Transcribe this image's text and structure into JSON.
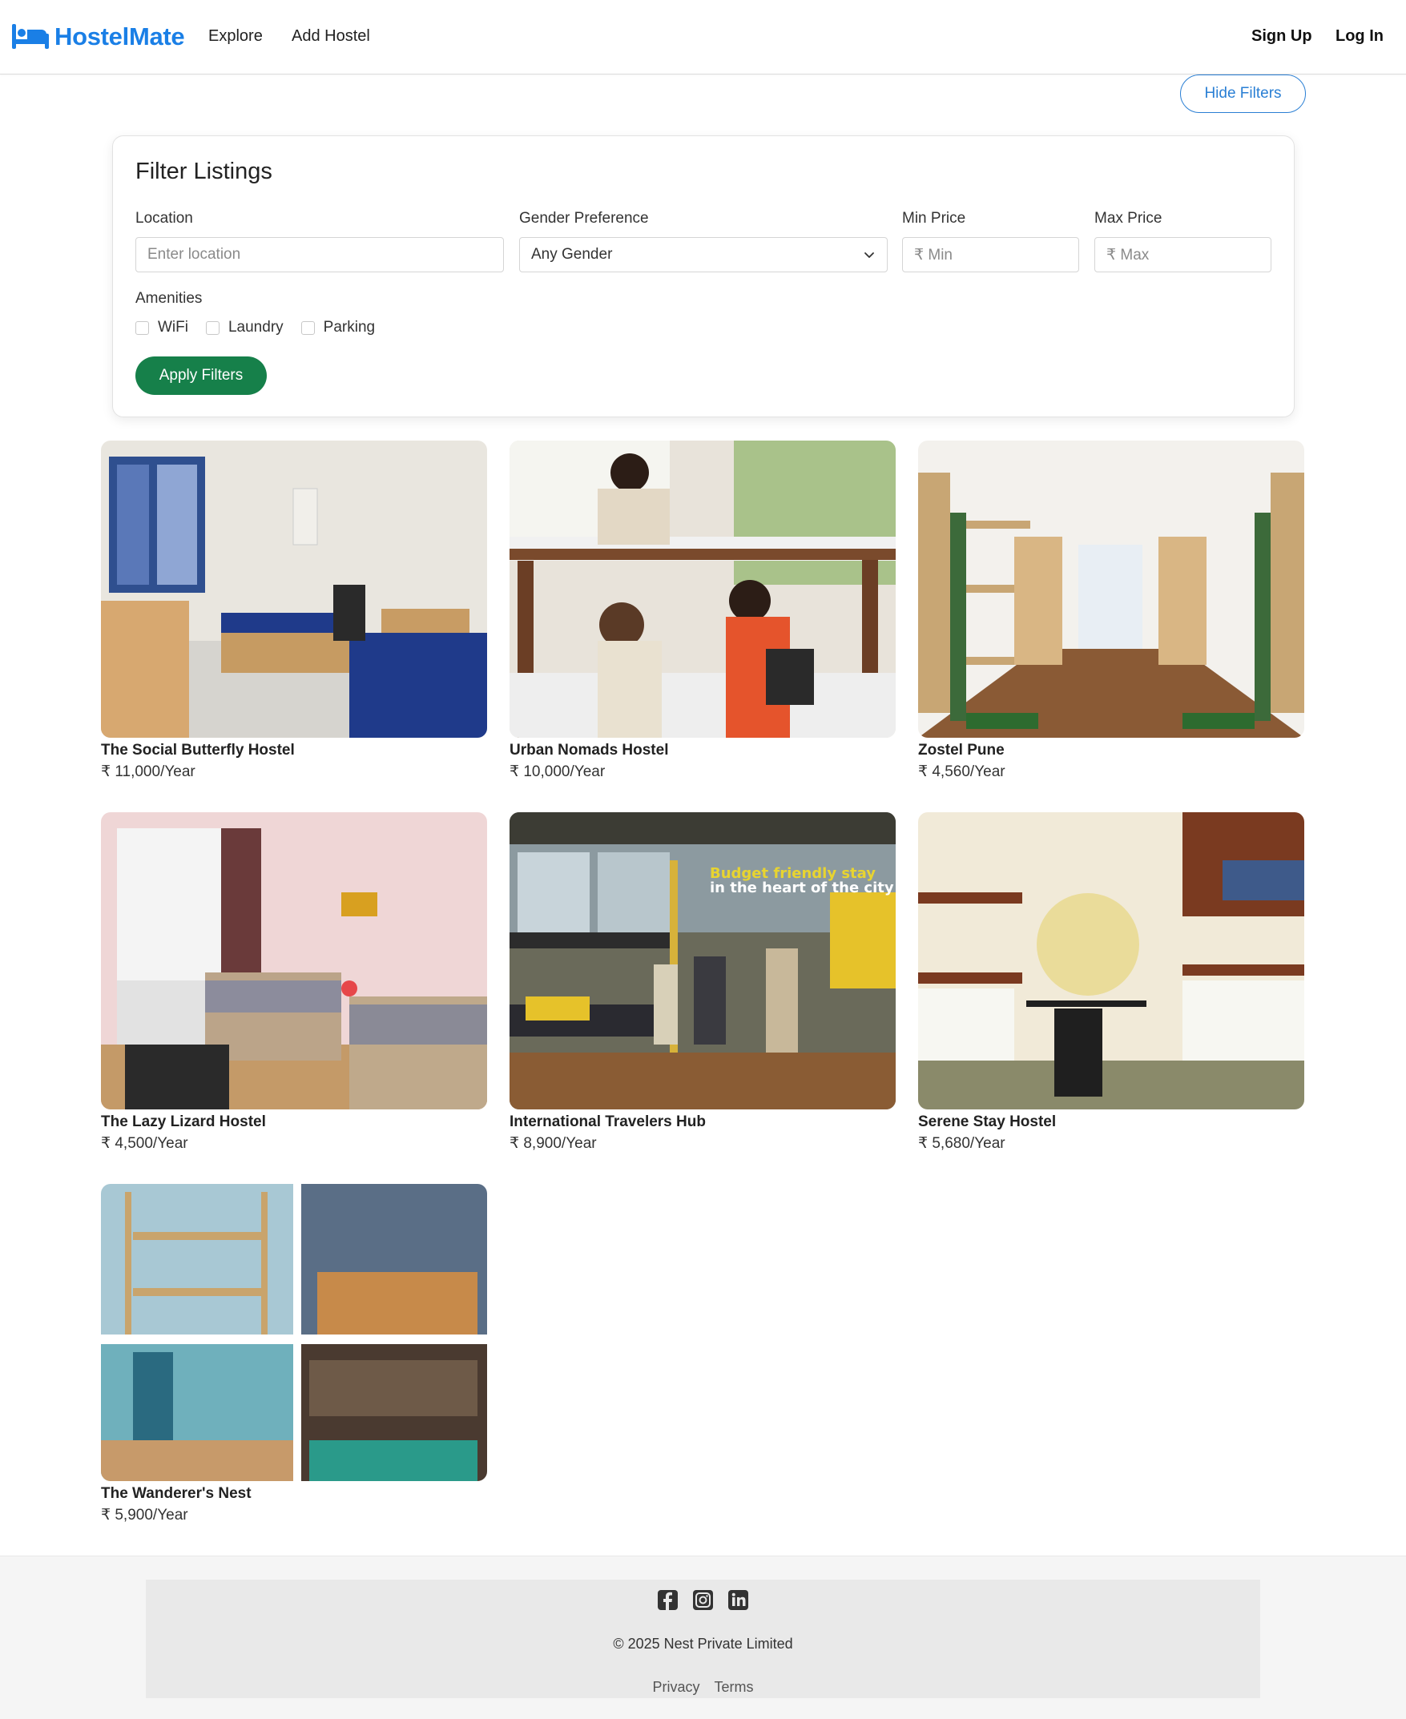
{
  "navbar": {
    "brand": "HostelMate",
    "links": {
      "explore": "Explore",
      "add_hostel": "Add Hostel"
    },
    "auth": {
      "sign_up": "Sign Up",
      "log_in": "Log In"
    },
    "brand_icon": "bed-icon"
  },
  "toggle_filters_label": "Hide Filters",
  "filter": {
    "title": "Filter Listings",
    "location_label": "Location",
    "location_placeholder": "Enter location",
    "gender_label": "Gender Preference",
    "gender_value": "Any Gender",
    "min_price_label": "Min Price",
    "min_price_placeholder": "₹ Min",
    "max_price_label": "Max Price",
    "max_price_placeholder": "₹ Max",
    "amenities_label": "Amenities",
    "amenities": [
      "WiFi",
      "Laundry",
      "Parking"
    ],
    "apply_label": "Apply Filters"
  },
  "listings": [
    {
      "name": "The Social Butterfly Hostel",
      "price": "₹ 11,000/Year"
    },
    {
      "name": "Urban Nomads Hostel",
      "price": "₹ 10,000/Year"
    },
    {
      "name": "Zostel Pune",
      "price": "₹ 4,560/Year"
    },
    {
      "name": "The Lazy Lizard Hostel",
      "price": "₹ 4,500/Year"
    },
    {
      "name": "International Travelers Hub",
      "price": "₹ 8,900/Year"
    },
    {
      "name": "Serene Stay Hostel",
      "price": "₹ 5,680/Year"
    },
    {
      "name": "The Wanderer's Nest",
      "price": "₹ 5,900/Year"
    }
  ],
  "listing_overlay_text": {
    "line1": "Budget friendly stay",
    "line2": "in the heart of the city"
  },
  "footer": {
    "social_icons": [
      "facebook-icon",
      "instagram-icon",
      "linkedin-icon"
    ],
    "copyright": "© 2025 Nest Private Limited",
    "links": {
      "privacy": "Privacy",
      "terms": "Terms"
    }
  },
  "colors": {
    "brand": "#1a7fe6",
    "apply_button": "#16804a",
    "outline_button": "#2a7fd4"
  }
}
